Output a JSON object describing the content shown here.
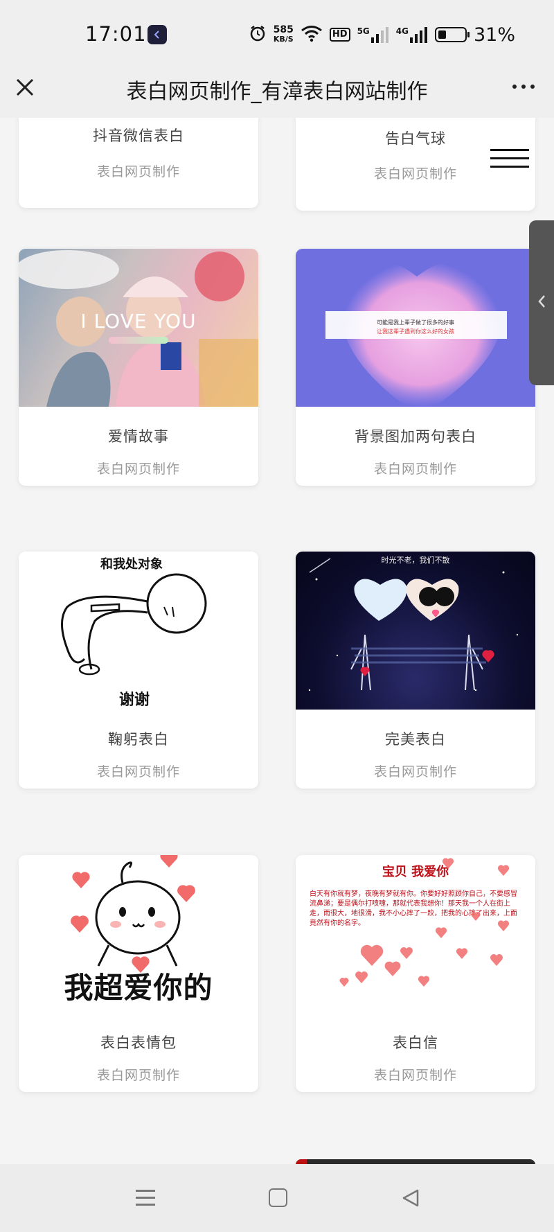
{
  "status_bar": {
    "time": "17:01",
    "net_speed_value": "585",
    "net_speed_unit": "KB/S",
    "hd_label": "HD",
    "signal1_tag": "5G",
    "signal2_tag": "4G",
    "battery_percent": "31%",
    "battery_level": 0.31
  },
  "app_bar": {
    "title": "表白网页制作_有漳表白网站制作"
  },
  "cards": [
    {
      "title": "抖音微信表白",
      "subtitle": "表白网页制作"
    },
    {
      "title": "告白气球",
      "subtitle": "表白网页制作"
    },
    {
      "title": "爱情故事",
      "subtitle": "表白网页制作",
      "thumb_text": "I LOVE YOU"
    },
    {
      "title": "背景图加两句表白",
      "subtitle": "表白网页制作",
      "thumb_line1": "可能是我上辈子做了很多的好事",
      "thumb_line2": "让我这辈子遇到你这么好的女孩"
    },
    {
      "title": "鞠躬表白",
      "subtitle": "表白网页制作",
      "thumb_top": "和我处对象",
      "thumb_bottom": "谢谢"
    },
    {
      "title": "完美表白",
      "subtitle": "表白网页制作",
      "thumb_caption": "时光不老，我们不散"
    },
    {
      "title": "表白表情包",
      "subtitle": "表白网页制作",
      "thumb_text": "我超爱你的"
    },
    {
      "title": "表白信",
      "subtitle": "表白网页制作",
      "thumb_heading": "宝贝 我爱你",
      "thumb_letter": "白天有你就有梦，夜晚有梦就有你。你要好好照顾你自己，不要感冒流鼻涕；要是偶尔打喷嚏，那就代表我想你！那天我一个人在街上走，雨很大，地很滑，我不小心摔了一跤，把我的心摔了出来，上面竟然有你的名字。"
    }
  ],
  "colors": {
    "accent_heart": "#f26b6b",
    "letter_red": "#c0101a"
  }
}
